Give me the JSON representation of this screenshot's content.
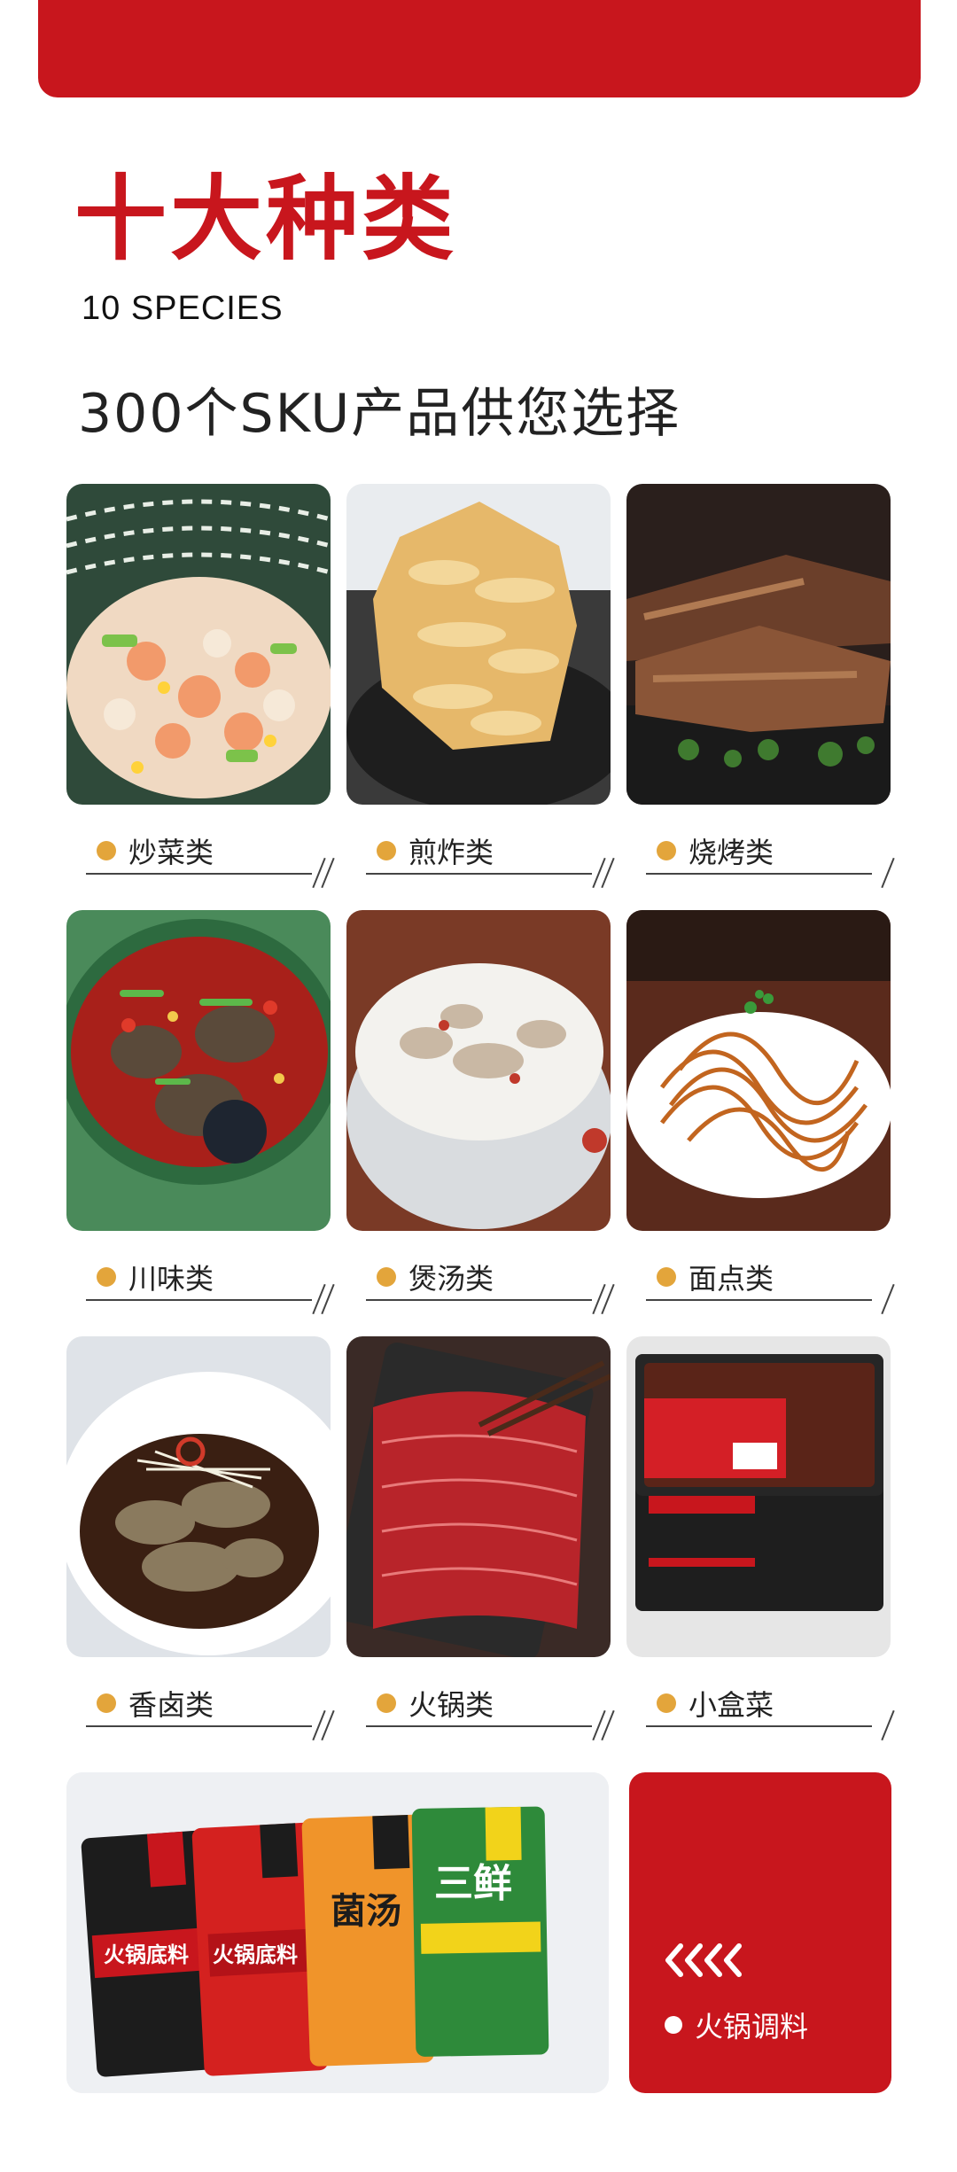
{
  "header": {
    "title": "十大种类",
    "subtitle": "10 SPECIES",
    "tagline": "300个SKU产品供您选择"
  },
  "categories": [
    {
      "label": "炒菜类",
      "image": "stir-fry-dish-photo"
    },
    {
      "label": "煎炸类",
      "image": "fried-food-photo"
    },
    {
      "label": "烧烤类",
      "image": "bbq-ribs-photo"
    },
    {
      "label": "川味类",
      "image": "sichuan-fish-photo"
    },
    {
      "label": "煲汤类",
      "image": "soup-pot-photo"
    },
    {
      "label": "面点类",
      "image": "noodles-photo"
    },
    {
      "label": "香卤类",
      "image": "braised-dish-photo"
    },
    {
      "label": "火锅类",
      "image": "hotpot-beef-photo"
    },
    {
      "label": "小盒菜",
      "image": "boxed-meal-photo"
    }
  ],
  "bottom": {
    "image": "hotpot-seasoning-packs-photo",
    "packs": [
      "火锅底料",
      "火锅底料",
      "菌汤",
      "三鲜"
    ],
    "label": "火锅调料"
  },
  "colors": {
    "brand_red": "#c8161d",
    "accent_gold": "#e3a53b",
    "text_dark": "#222222"
  }
}
